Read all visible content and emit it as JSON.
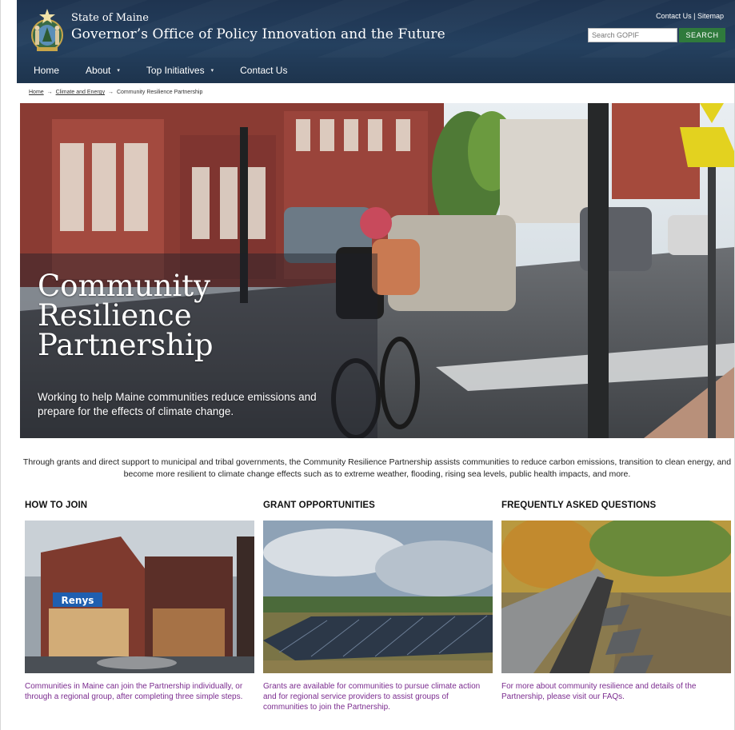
{
  "header": {
    "state_name": "State of Maine",
    "office_name": "Governor’s Office of Policy Innovation and the Future",
    "contact_link": "Contact Us",
    "utility_sep": "|",
    "sitemap_link": "Sitemap",
    "search_placeholder": "Search GOPIF",
    "search_button": "SEARCH"
  },
  "nav": {
    "items": [
      {
        "label": "Home",
        "has_dropdown": false
      },
      {
        "label": "About",
        "has_dropdown": true
      },
      {
        "label": "Top Initiatives",
        "has_dropdown": true
      },
      {
        "label": "Contact Us",
        "has_dropdown": false
      }
    ],
    "caret": "▾"
  },
  "breadcrumb": {
    "home": "Home",
    "climate": "Climate and Energy",
    "current": "Community Resilience Partnership",
    "arrow": "→"
  },
  "hero": {
    "title": "Community Resilience Partnership",
    "subtitle": "Working to help Maine communities reduce emissions and prepare for the effects of climate change."
  },
  "intro": "Through grants and direct support to municipal and tribal governments, the Community Resilience Partnership assists communities to reduce carbon emissions, transition to clean energy, and become more resilient to climate change effects such as to extreme weather, flooding, rising sea levels, public health impacts, and more.",
  "columns": [
    {
      "heading": "HOW TO JOIN",
      "text": "Communities in Maine can join the Partnership individually, or through a regional group, after completing three simple steps."
    },
    {
      "heading": "GRANT OPPORTUNITIES",
      "text": "Grants are available for communities to pursue climate action and for regional service providers to assist groups of communities to join the Partnership."
    },
    {
      "heading": "FREQUENTLY ASKED QUESTIONS",
      "text": "For more about community resilience and details of the Partnership, please visit our FAQs."
    }
  ],
  "store_sign": "Renys",
  "colors": {
    "header_bg": "#23395a",
    "search_button": "#2f7a3c",
    "link_purple": "#7b2c8f"
  }
}
